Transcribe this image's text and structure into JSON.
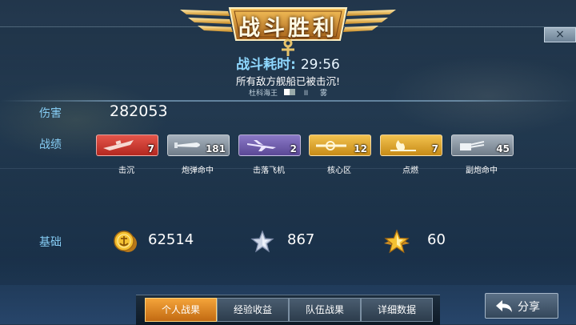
{
  "header": {
    "title": "战斗胜利",
    "close_label": "×"
  },
  "battle": {
    "time_label": "战斗耗时:",
    "time_value": "29:56",
    "summary": "所有敌方舰船已被击沉!",
    "player_name": "杜科海王",
    "player_tag": "II",
    "player_extra": "雾"
  },
  "stats": {
    "damage_label": "伤害",
    "damage_value": "282053",
    "record_label": "战绩",
    "medals": [
      {
        "label": "击沉",
        "count": "7",
        "icon": "ship-sinking-icon",
        "color": "#c9362c"
      },
      {
        "label": "炮弹命中",
        "count": "181",
        "icon": "shell-icon",
        "color": "#8a97a4"
      },
      {
        "label": "击落飞机",
        "count": "2",
        "icon": "plane-icon",
        "color": "#6a58a8"
      },
      {
        "label": "核心区",
        "count": "12",
        "icon": "core-hit-icon",
        "color": "#dca530"
      },
      {
        "label": "点燃",
        "count": "7",
        "icon": "fire-icon",
        "color": "#dca530"
      },
      {
        "label": "副炮命中",
        "count": "45",
        "icon": "secondary-gun-icon",
        "color": "#8a97a4"
      }
    ],
    "base_label": "基础",
    "base": [
      {
        "icon": "gold-coin-icon",
        "value": "62514"
      },
      {
        "icon": "silver-star-icon",
        "value": "867"
      },
      {
        "icon": "gold-star-icon",
        "value": "60"
      }
    ]
  },
  "tabs": [
    {
      "label": "个人战果",
      "active": true
    },
    {
      "label": "经验收益",
      "active": false
    },
    {
      "label": "队伍战果",
      "active": false
    },
    {
      "label": "详细数据",
      "active": false
    }
  ],
  "share": {
    "label": "分享",
    "icon": "share-arrow-icon"
  }
}
